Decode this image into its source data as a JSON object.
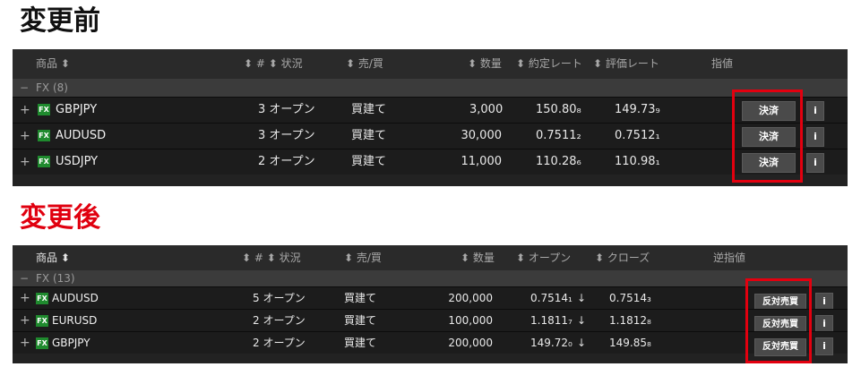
{
  "before": {
    "heading": "変更前",
    "header": {
      "product": "商品 ⬍",
      "status": "⬍ # ⬍ 状況",
      "side": "⬍ 売/買",
      "qty": "⬍ 数量",
      "col5": "⬍ 約定レート",
      "col6": "⬍ 評価レート",
      "col7": "指値"
    },
    "group": {
      "minus": "−",
      "label": "FX (8)"
    },
    "rows": [
      {
        "plus": "+",
        "fx": "FX",
        "symbol": "GBPJPY",
        "status": "3 オープン",
        "side": "買建て",
        "qty": "3,000",
        "v1": "150.80₈",
        "v2": "149.73₉",
        "button": "決済",
        "info": "i"
      },
      {
        "plus": "+",
        "fx": "FX",
        "symbol": "AUDUSD",
        "status": "3 オープン",
        "side": "買建て",
        "qty": "30,000",
        "v1": "0.7511₂",
        "v2": "0.7512₁",
        "button": "決済",
        "info": "i"
      },
      {
        "plus": "+",
        "fx": "FX",
        "symbol": "USDJPY",
        "status": "2 オープン",
        "side": "買建て",
        "qty": "11,000",
        "v1": "110.28₆",
        "v2": "110.98₁",
        "button": "決済",
        "info": "i"
      }
    ]
  },
  "after": {
    "heading": "変更後",
    "header": {
      "product": "商品 ⬍",
      "status": "⬍ # ⬍ 状況",
      "side": "⬍ 売/買",
      "qty": "⬍ 数量",
      "col5": "⬍ オープン",
      "col6": "⬍ クローズ",
      "col7": "逆指値"
    },
    "group": {
      "minus": "−",
      "label": "FX (13)"
    },
    "rows": [
      {
        "plus": "+",
        "fx": "FX",
        "symbol": "AUDUSD",
        "status": "5 オープン",
        "side": "買建て",
        "qty": "200,000",
        "v1": "0.7514₁",
        "arrow": "↓",
        "v2": "0.7514₃",
        "button": "反対売買",
        "info": "i"
      },
      {
        "plus": "+",
        "fx": "FX",
        "symbol": "EURUSD",
        "status": "2 オープン",
        "side": "買建て",
        "qty": "100,000",
        "v1": "1.1811₇",
        "arrow": "↓",
        "v2": "1.1812₈",
        "button": "反対売買",
        "info": "i"
      },
      {
        "plus": "+",
        "fx": "FX",
        "symbol": "GBPJPY",
        "status": "2 オープン",
        "side": "買建て",
        "qty": "200,000",
        "v1": "149.72₀",
        "arrow": "↓",
        "v2": "149.85₈",
        "button": "反対売買",
        "info": "i"
      }
    ]
  },
  "colors": {
    "accent_red": "#e3000f",
    "panel_bg": "#222222",
    "fx_badge": "#1f8a2e"
  }
}
